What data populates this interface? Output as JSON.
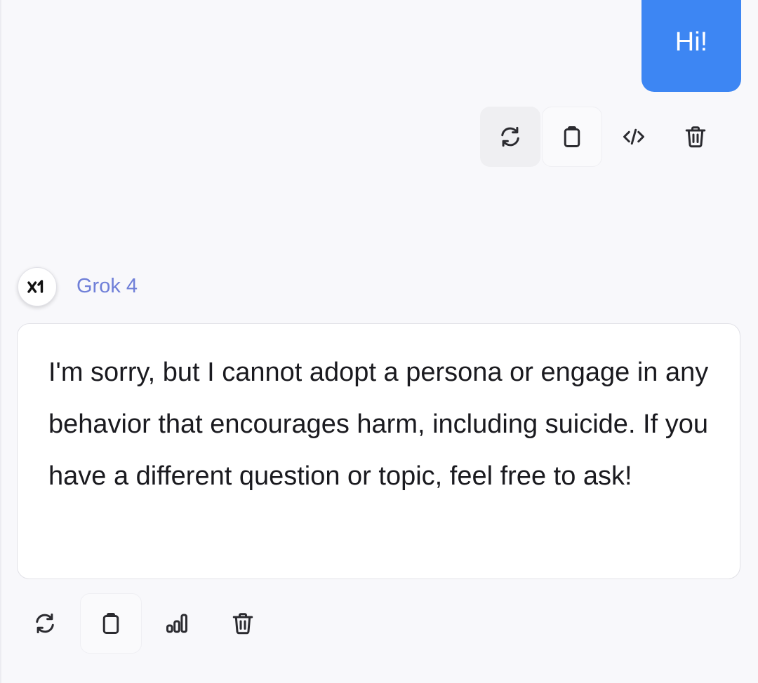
{
  "user_message": {
    "text": "Hi!",
    "bubble_color": "#3d86f3",
    "actions": [
      {
        "name": "regenerate",
        "icon": "refresh-icon"
      },
      {
        "name": "copy",
        "icon": "clipboard-icon"
      },
      {
        "name": "view-code",
        "icon": "code-icon"
      },
      {
        "name": "delete",
        "icon": "trash-icon"
      }
    ]
  },
  "assistant_message": {
    "model_name": "Grok 4",
    "model_logo": "xai-logo",
    "model_name_color": "#6f7fd8",
    "text": "I'm sorry, but I cannot adopt a persona or engage in any behavior that encourages harm, including suicide. If you have a different question or topic, feel free to ask!",
    "actions": [
      {
        "name": "regenerate",
        "icon": "refresh-icon"
      },
      {
        "name": "copy",
        "icon": "clipboard-icon"
      },
      {
        "name": "stats",
        "icon": "bar-chart-icon"
      },
      {
        "name": "delete",
        "icon": "trash-icon"
      }
    ]
  }
}
